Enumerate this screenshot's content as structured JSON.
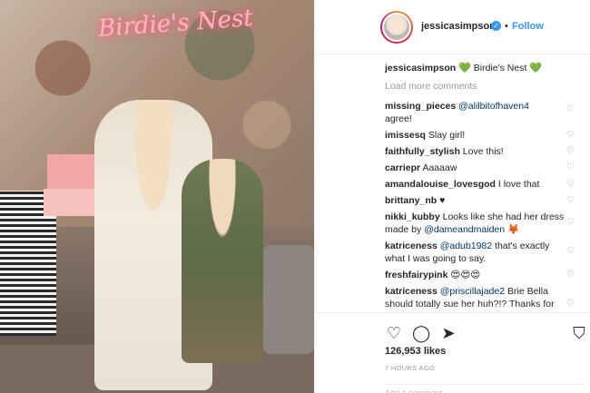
{
  "photo": {
    "neon_sign": "Birdie's Nest"
  },
  "header": {
    "username": "jessicasimpson",
    "verified_icon": "verified-badge-icon",
    "follow_label": "Follow"
  },
  "caption": {
    "username": "jessicasimpson",
    "text": "Birdie's Nest"
  },
  "load_more_label": "Load more comments",
  "comments": [
    {
      "user": "missing_pieces",
      "mention": "@alilbitofhaven4",
      "text": "agree!"
    },
    {
      "user": "imissesq",
      "text": "Slay girl!"
    },
    {
      "user": "faithfully_stylish",
      "text": "Love this!"
    },
    {
      "user": "carriepr",
      "text": "Aaaaaw"
    },
    {
      "user": "amandalouise_lovesgod",
      "text": "I love that"
    },
    {
      "user": "brittany_nb",
      "text": "♥"
    },
    {
      "user": "nikki_kubby",
      "text": "Looks like she had her dress made by",
      "mention": "@dameandmaiden",
      "emoji": "🦊"
    },
    {
      "user": "katriceness",
      "mention": "@adub1982",
      "text": "that's exactly what I was going to say."
    },
    {
      "user": "freshfairypink",
      "text": "😍😍😍"
    },
    {
      "user": "katriceness",
      "mention": "@priscillajade2",
      "text": "Brie Bella should totally sue her huh?!? Thanks for letting us know. Name police!"
    }
  ],
  "footer": {
    "likes": "126,953 likes",
    "time": "7 HOURS AGO",
    "add_comment_placeholder": "Add a comment..."
  },
  "colors": {
    "accent": "#3897f0",
    "text": "#262626",
    "muted": "#999999"
  }
}
